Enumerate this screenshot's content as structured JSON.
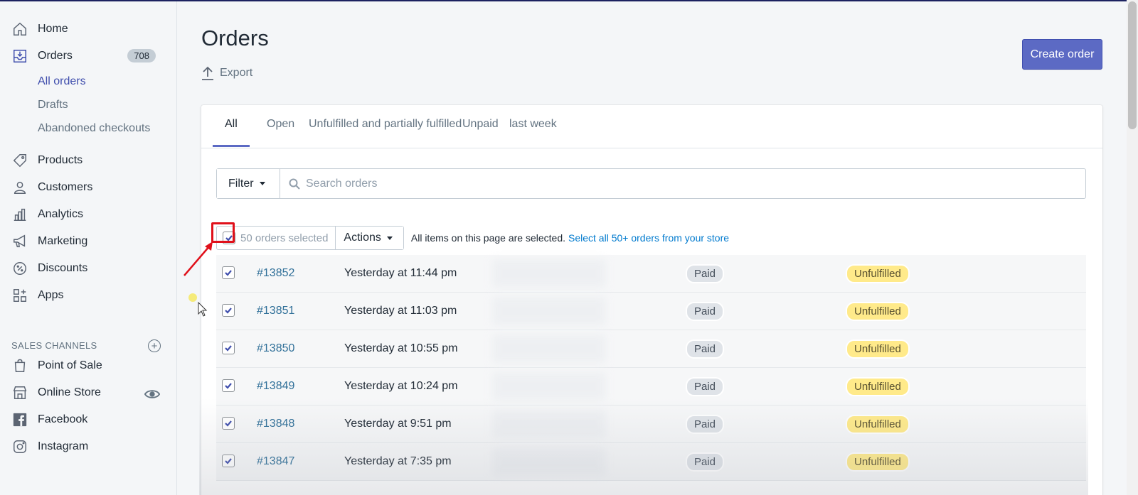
{
  "sidebar": {
    "items": [
      {
        "label": "Home",
        "icon": "home-icon"
      },
      {
        "label": "Orders",
        "icon": "orders-icon",
        "badge": "708"
      },
      {
        "label": "Products",
        "icon": "tag-icon"
      },
      {
        "label": "Customers",
        "icon": "person-icon"
      },
      {
        "label": "Analytics",
        "icon": "bar-chart-icon"
      },
      {
        "label": "Marketing",
        "icon": "megaphone-icon"
      },
      {
        "label": "Discounts",
        "icon": "discount-icon"
      },
      {
        "label": "Apps",
        "icon": "apps-icon"
      }
    ],
    "order_subitems": [
      "All orders",
      "Drafts",
      "Abandoned checkouts"
    ],
    "sales_channels_label": "SALES CHANNELS",
    "channels": [
      {
        "label": "Point of Sale",
        "icon": "shopping-bag-icon"
      },
      {
        "label": "Online Store",
        "icon": "store-icon"
      },
      {
        "label": "Facebook",
        "icon": "facebook-icon"
      },
      {
        "label": "Instagram",
        "icon": "instagram-icon"
      }
    ]
  },
  "header": {
    "title": "Orders",
    "export_label": "Export",
    "create_label": "Create order"
  },
  "tabs": [
    "All",
    "Open",
    "Unfulfilled and partially fulfilled",
    "Unpaid",
    "last week"
  ],
  "filter": {
    "button_label": "Filter",
    "search_placeholder": "Search orders"
  },
  "bulk": {
    "selected_label": "50 orders selected",
    "actions_label": "Actions",
    "message": "All items on this page are selected.",
    "link": "Select all 50+ orders from your store"
  },
  "orders": [
    {
      "id": "#13852",
      "date": "Yesterday at 11:44 pm",
      "payment": "Paid",
      "fulfillment": "Unfulfilled"
    },
    {
      "id": "#13851",
      "date": "Yesterday at 11:03 pm",
      "payment": "Paid",
      "fulfillment": "Unfulfilled"
    },
    {
      "id": "#13850",
      "date": "Yesterday at 10:55 pm",
      "payment": "Paid",
      "fulfillment": "Unfulfilled"
    },
    {
      "id": "#13849",
      "date": "Yesterday at 10:24 pm",
      "payment": "Paid",
      "fulfillment": "Unfulfilled"
    },
    {
      "id": "#13848",
      "date": "Yesterday at 9:51 pm",
      "payment": "Paid",
      "fulfillment": "Unfulfilled"
    },
    {
      "id": "#13847",
      "date": "Yesterday at 7:35 pm",
      "payment": "Paid",
      "fulfillment": "Unfulfilled"
    }
  ],
  "colors": {
    "accent": "#5c6ac4",
    "link": "#007ace",
    "unfulfilled_badge": "#ffea8a",
    "paid_badge": "#dfe3e8",
    "highlight": "#e0101a"
  }
}
